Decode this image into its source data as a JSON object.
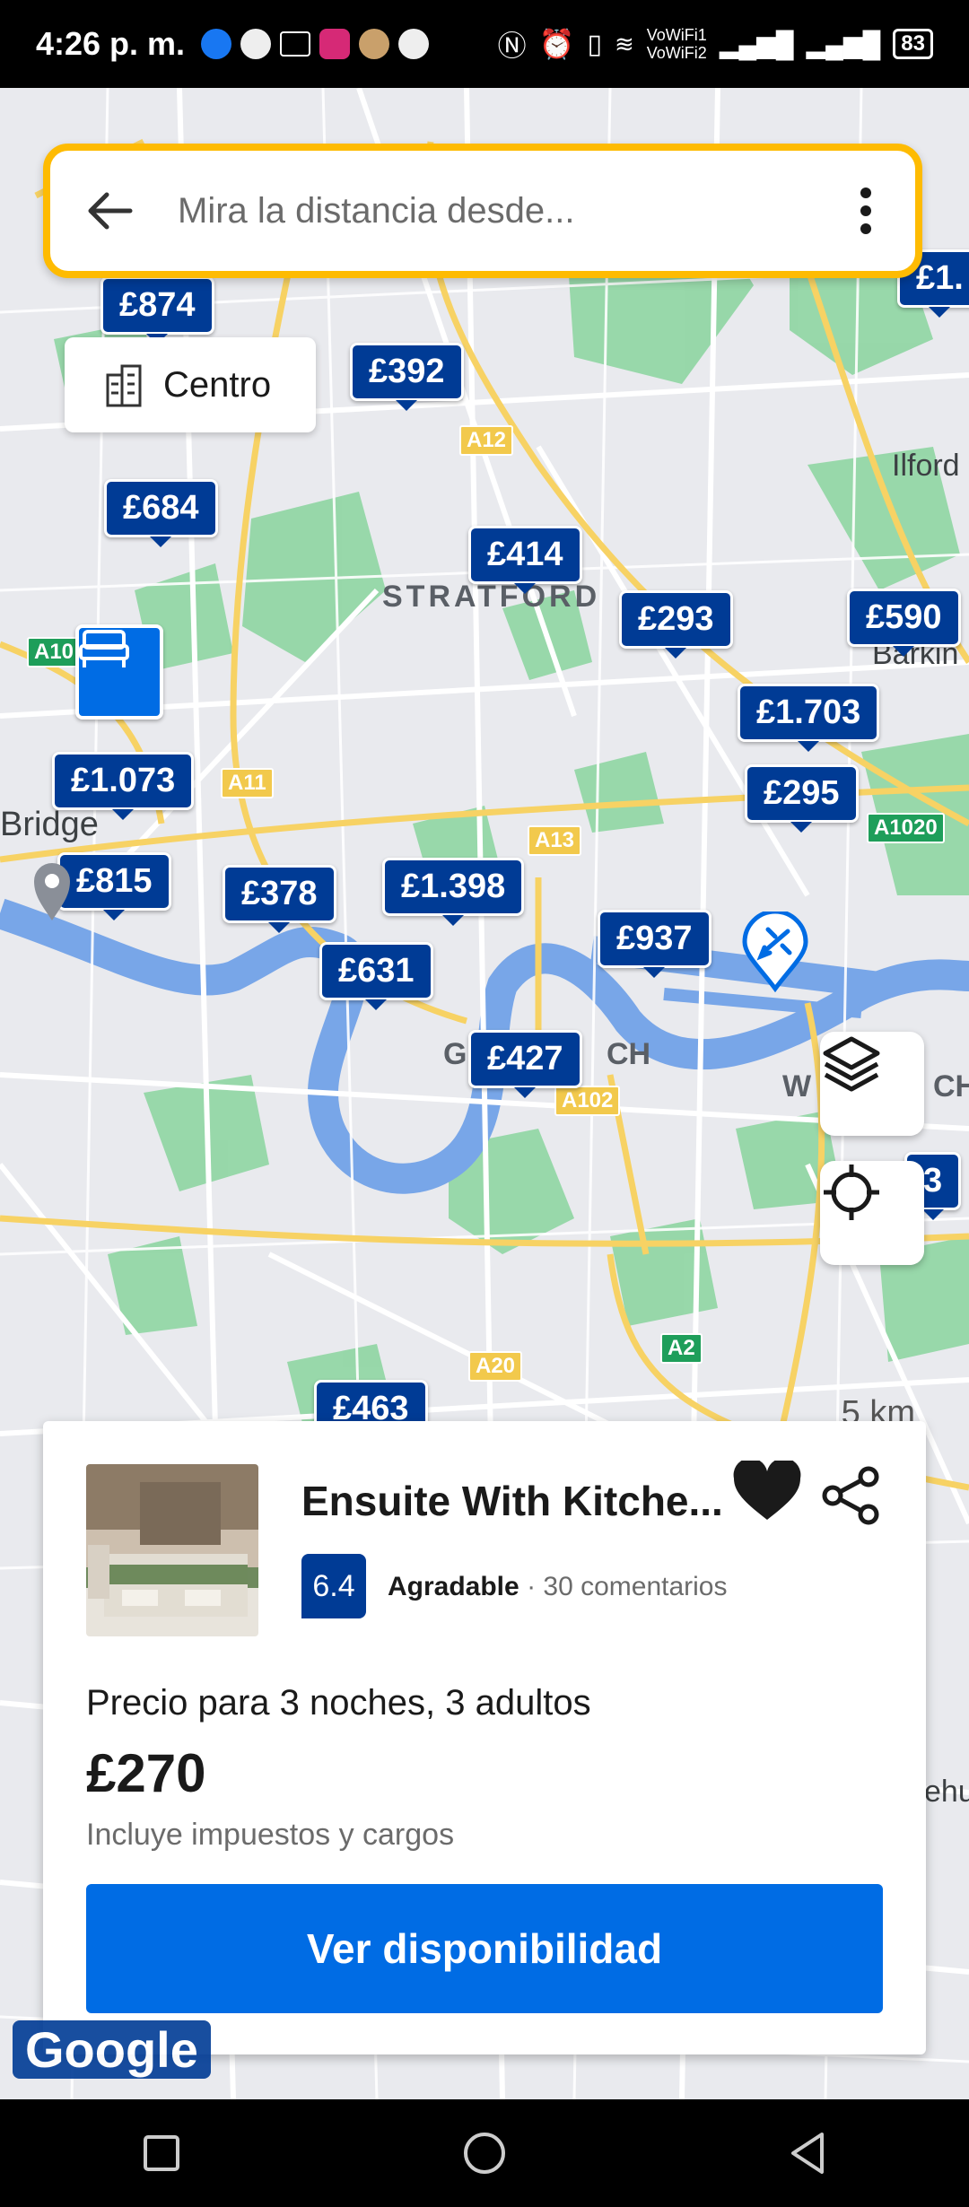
{
  "status": {
    "time": "4:26 p. m.",
    "vowifi1": "VoWiFi1",
    "vowifi2": "VoWiFi2",
    "battery": "83"
  },
  "search": {
    "placeholder": "Mira la distancia desde..."
  },
  "centro": {
    "label": "Centro"
  },
  "map_labels": {
    "stratford": "STRATFORD",
    "greenwich_left": "G",
    "greenwich_right": "CH",
    "ilford": "Ilford",
    "barking": "Barkin",
    "bridge": "Bridge",
    "woolwich_left": "W",
    "woolwich_right": "CH",
    "rehu": "ehu"
  },
  "road_tags": {
    "a12": "A12",
    "a10": "A10",
    "a11": "A11",
    "a13": "A13",
    "a1020": "A1020",
    "a102": "A102",
    "a20": "A20",
    "a2": "A2"
  },
  "pins": {
    "p874": "£874",
    "p392": "£392",
    "p684": "£684",
    "p414": "£414",
    "p293": "£293",
    "p590": "£590",
    "p1703": "£1.703",
    "p1073": "£1.073",
    "p295": "£295",
    "p815": "£815",
    "p378": "£378",
    "p1398": "£1.398",
    "p937": "£937",
    "p631": "£631",
    "p427": "£427",
    "p463": "£463",
    "p1top": "£1.",
    "p3": "3"
  },
  "scale": {
    "label": "5 km"
  },
  "card": {
    "title": "Ensuite With Kitche...",
    "score": "6.4",
    "score_label": "Agradable",
    "reviews": "· 30 comentarios",
    "price_for": "Precio para 3 noches, 3 adultos",
    "price": "£270",
    "taxes": "Incluye impuestos y cargos",
    "cta": "Ver disponibilidad"
  },
  "google_logo": "Google",
  "colors": {
    "brand_blue": "#003b95",
    "cta_blue": "#006ce4",
    "search_border": "#febb02"
  }
}
